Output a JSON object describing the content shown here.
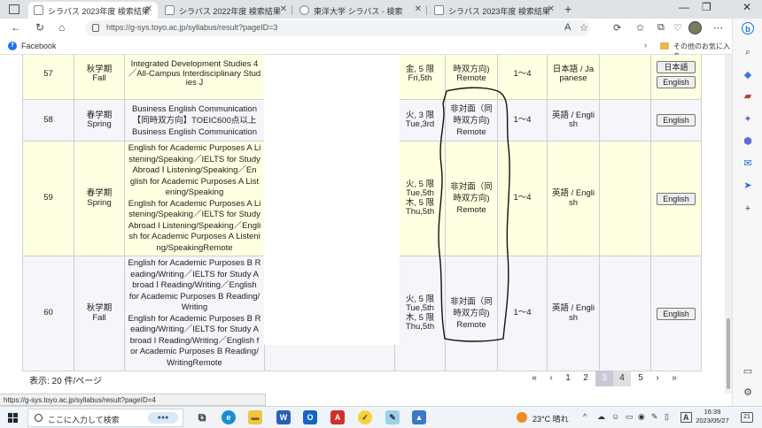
{
  "browser": {
    "tabs": [
      {
        "label": "シラバス 2023年度 検索結果"
      },
      {
        "label": "シラバス 2022年度 検索結果"
      },
      {
        "label": "東洋大学 シラバス - 検索"
      },
      {
        "label": "シラバス 2023年度 検索結果"
      }
    ],
    "url": "https://g-sys.toyo.ac.jp/syllabus/result?pageID=3",
    "favorites": {
      "facebook": "Facebook",
      "other": "その他のお気に入り"
    }
  },
  "rows": [
    {
      "no": "57",
      "term": "秋学期\nFall",
      "title": "Integrated Development Studies 4\n／All-Campus Interdisciplinary Stud\nies J",
      "schedule": "金, 5 限\nFri,5th",
      "method": "時双方向)\nRemote",
      "grade": "1〜4",
      "language": "日本語 / Ja\npanese",
      "btn_top": "日本語",
      "btn": "English"
    },
    {
      "no": "58",
      "term": "春学期\nSpring",
      "title": "Business English Communication\n【同時双方向】TOEIC600点以上\nBusiness English Communication",
      "schedule": "火, 3 限\nTue,3rd",
      "method": "非対面（同\n時双方向)\nRemote",
      "grade": "1〜4",
      "language": "英語 / Engli\nsh",
      "btn": "English"
    },
    {
      "no": "59",
      "term": "春学期\nSpring",
      "title": "English for Academic Purposes A Li\nstening/Speaking／IELTS for Study\nAbroad Ⅰ Listening/Speaking／En\nglish for Academic Purposes A List\nening/Speaking\nEnglish for Academic Purposes A Li\nstening/Speaking／IELTS for Study\nAbroad I Listening/Speaking／Engli\nsh for Academic Purposes A Listeni\nng/SpeakingRemote",
      "schedule": "火, 5 限\nTue,5th\n木, 5 限\nThu,5th",
      "method": "非対面（同\n時双方向)\nRemote",
      "grade": "1〜4",
      "language": "英語 / Engli\nsh",
      "btn": "English"
    },
    {
      "no": "60",
      "term": "秋学期\nFall",
      "title": "English for Academic Purposes B R\neading/Writing／IELTS for Study A\nbroad Ⅰ Reading/Writing／English\nfor Academic Purposes B Reading/\nWriting\nEnglish for Academic Purposes B R\neading/Writing／IELTS for Study A\nbroad I Reading/Writing／English f\nor Academic Purposes B Reading/\nWritingRemote",
      "schedule": "火, 5 限\nTue,5th\n木, 5 限\nThu,5th",
      "method": "非対面（同\n時双方向)\nRemote",
      "grade": "1〜4",
      "language": "英語 / Engli\nsh",
      "btn": "English"
    }
  ],
  "footer": {
    "per_page": "表示: 20 件/ページ",
    "pager": [
      "«",
      "‹",
      "1",
      "2",
      "3",
      "4",
      "5",
      "›",
      "»"
    ],
    "current_page": "3"
  },
  "status_url": "https://g-sys.toyo.ac.jp/syllabus/result?pageID=4",
  "taskbar": {
    "search_placeholder": "ここに入力して検索",
    "weather": "23°C  晴れ",
    "time": "16:39",
    "date": "2023/05/27",
    "ime": "A",
    "notifications": "21"
  }
}
